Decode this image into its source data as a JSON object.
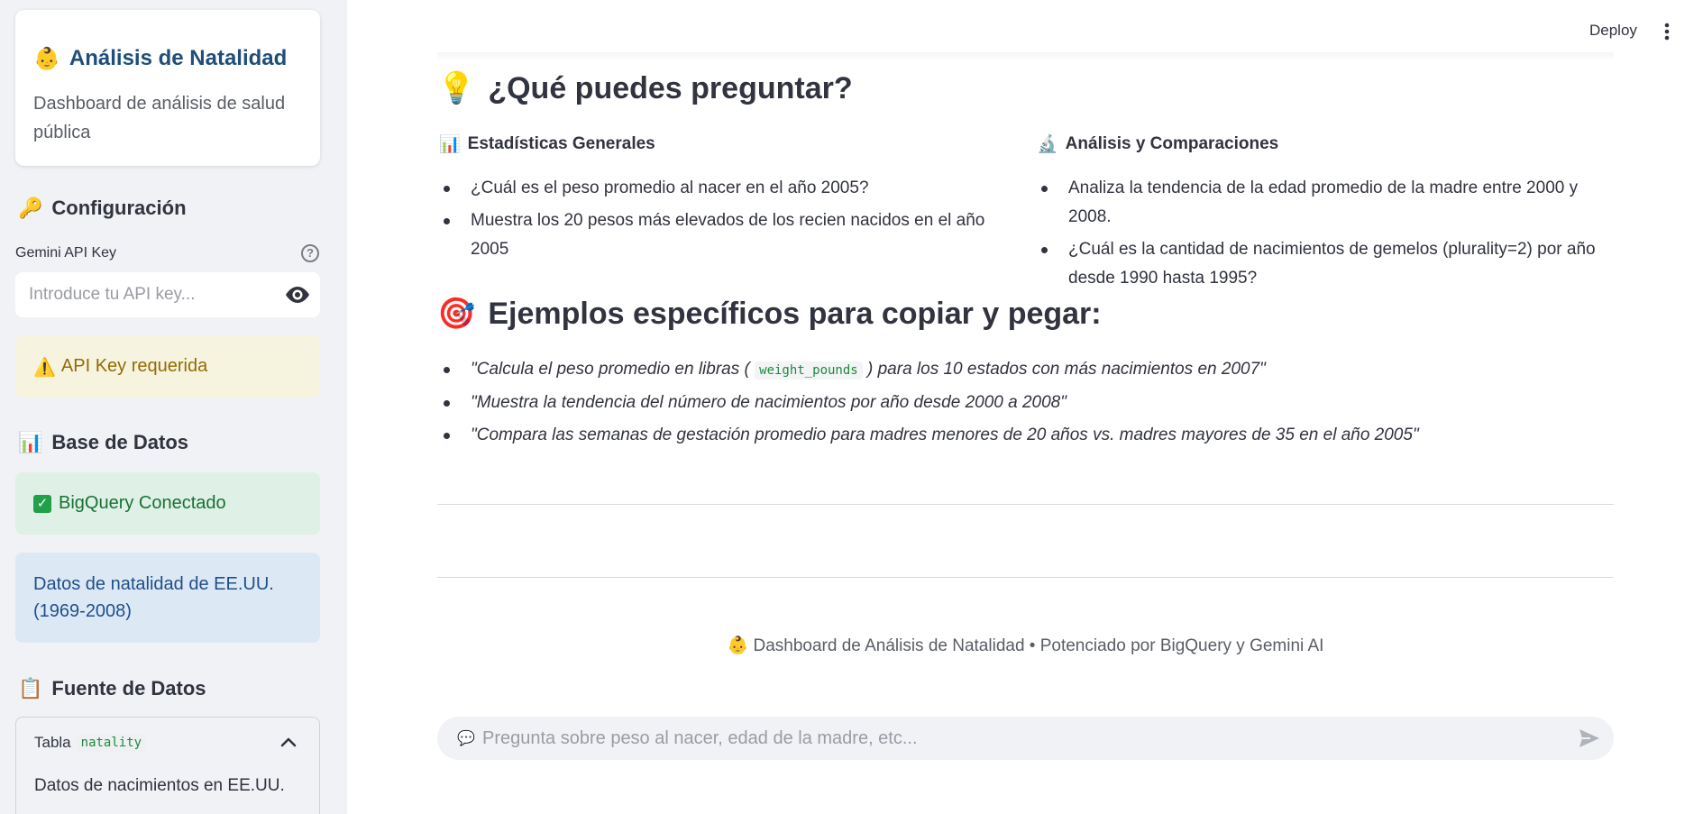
{
  "sidebar": {
    "brand": {
      "icon": "baby-emoji",
      "emoji": "👶",
      "title": "Análisis de Natalidad",
      "subtitle": "Dashboard de análisis de salud pública"
    },
    "config": {
      "icon": "key-emoji",
      "emoji": "🔑",
      "title": "Configuración"
    },
    "api_key": {
      "label": "Gemini API Key",
      "placeholder": "Introduce tu API key...",
      "value": ""
    },
    "warning": {
      "emoji": "⚠️",
      "text": "API Key requerida"
    },
    "database": {
      "emoji": "📊",
      "title": "Base de Datos"
    },
    "connected": {
      "text": "BigQuery Conectado"
    },
    "info": {
      "text": "Datos de natalidad de EE.UU. (1969-2008)"
    },
    "source": {
      "emoji": "📋",
      "title": "Fuente de Datos"
    },
    "table_expander": {
      "label": "Tabla",
      "code": "natality",
      "body": "Datos de nacimientos en EE.UU.",
      "expanded": true
    }
  },
  "header": {
    "deploy": "Deploy"
  },
  "main": {
    "questions": {
      "emoji": "💡",
      "title": "¿Qué puedes preguntar?",
      "columns": [
        {
          "emoji": "📊",
          "title": "Estadísticas Generales",
          "items": [
            "¿Cuál es el peso promedio al nacer en el año 2005?",
            "Muestra los 20 pesos más elevados de los recien nacidos en el año 2005"
          ]
        },
        {
          "emoji": "🔬",
          "title": "Análisis y Comparaciones",
          "items": [
            "Analiza la tendencia de la edad promedio de la madre entre 2000 y 2008.",
            "¿Cuál es la cantidad de nacimientos de gemelos (plurality=2) por año desde 1990 hasta 1995?"
          ]
        }
      ]
    },
    "examples": {
      "emoji": "🎯",
      "title": "Ejemplos específicos para copiar y pegar:",
      "item1_before": "\"Calcula el peso promedio en libras (",
      "item1_code": "weight_pounds",
      "item1_after": ") para los 10 estados con más nacimientos en 2007\"",
      "item2": "\"Muestra la tendencia del número de nacimientos por año desde 2000 a 2008\"",
      "item3": "\"Compara las semanas de gestación promedio para madres menores de 20 años vs. madres mayores de 35 en el año 2005\""
    },
    "footer": "👶 Dashboard de Análisis de Natalidad • Potenciado por BigQuery y Gemini AI",
    "chat": {
      "icon": "speech-balloon-icon",
      "emoji": "💬",
      "placeholder": "Pregunta sobre peso al nacer, edad de la madre, etc..."
    }
  },
  "colors": {
    "sidebar_bg": "#f0f2f6",
    "brand_title": "#1f4e79",
    "warning_bg": "#f6f3de",
    "warning_text": "#926c05",
    "success_bg": "#dff0e6",
    "success_text": "#177233",
    "info_bg": "#dde8f5",
    "info_text": "#1d4f8a",
    "code_text": "#1c8a3c"
  }
}
